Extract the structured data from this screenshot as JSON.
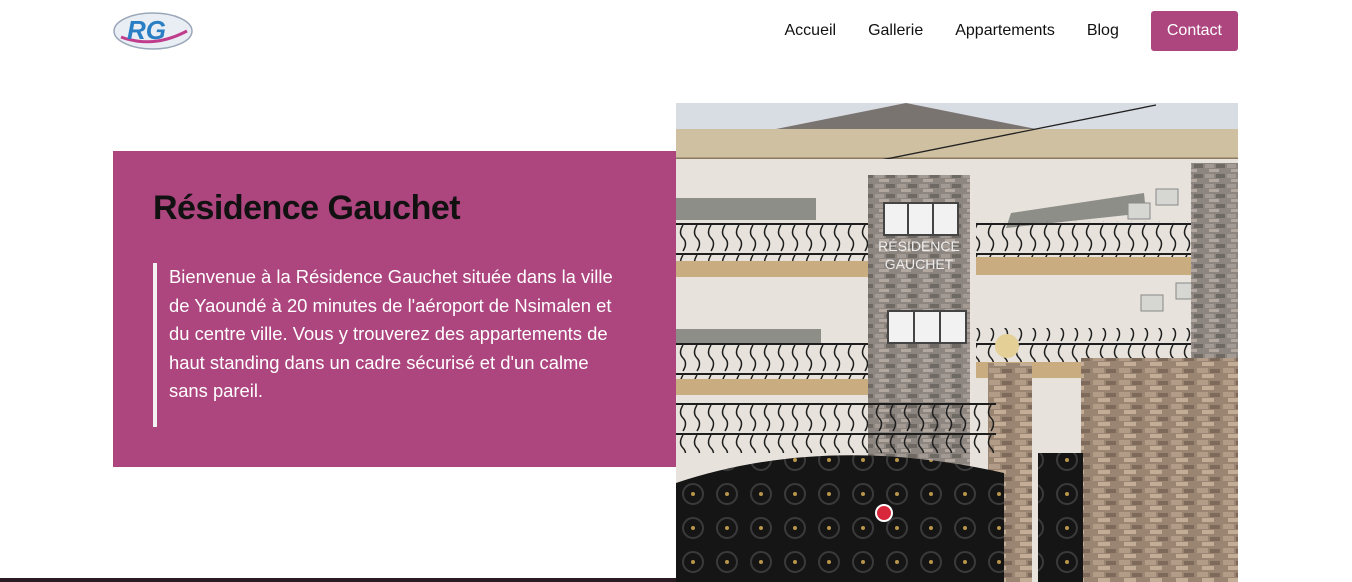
{
  "header": {
    "logo_text": "RG",
    "nav": [
      {
        "label": "Accueil"
      },
      {
        "label": "Gallerie"
      },
      {
        "label": "Appartements"
      },
      {
        "label": "Blog"
      }
    ],
    "contact_label": "Contact"
  },
  "hero": {
    "title": "Résidence Gauchet",
    "description": "Bienvenue à la Résidence Gauchet située dans la ville de Yaoundé à 20 minutes de l'aéroport de Nsimalen et du centre ville. Vous y trouverez des appartements de haut standing dans un cadre sécurisé et d'un calme sans pareil.",
    "photo_sign": [
      "RÉSIDENCE",
      "GAUCHET"
    ]
  },
  "colors": {
    "accent": "#ad457f",
    "text": "#111111"
  }
}
